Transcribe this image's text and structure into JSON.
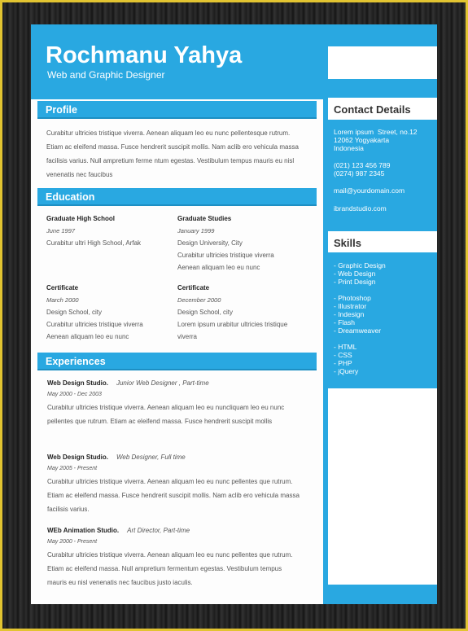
{
  "header": {
    "name": "Rochmanu Yahya",
    "role": "Web and Graphic Designer"
  },
  "profile": {
    "title": "Profile",
    "text": "Curabitur ultricies tristique viverra. Aenean aliquam leo eu nunc pellentesque rutrum. Etiam ac eleifend massa. Fusce hendrerit suscipit mollis. Nam aclib ero vehicula massa facilisis varius. Null ampretium ferme ntum egestas. Vestibulum tempus mauris eu nisl venenatis nec faucibus"
  },
  "education": {
    "title": "Education",
    "items": [
      {
        "title": "Graduate High School",
        "date": "June 1997",
        "lines": "Curabitur ultri High School, Arfak"
      },
      {
        "title": "Graduate Studies",
        "date": "January 1999",
        "lines": "Design University, City\nCurabitur ultricies tristique viverra\nAenean aliquam leo eu nunc"
      },
      {
        "title": "Certificate",
        "date": "March 2000",
        "lines": "Design School, city\nCurabitur ultricies tristique viverra\nAenean aliquam leo eu nunc"
      },
      {
        "title": "Certificate",
        "date": "December 2000",
        "lines": "Design School, city\nLorem ipsum urabitur ultricies tristique\nviverra"
      }
    ]
  },
  "experiences": {
    "title": "Experiences",
    "items": [
      {
        "company": "Web Design Studio.",
        "position": "Junior Web Designer , Part-time",
        "date": "May 2000 - Dec 2003",
        "text": "Curabitur ultricies tristique viverra. Aenean aliquam leo eu nuncliquam leo eu nunc pellentes que rutrum. Etiam ac eleifend massa. Fusce hendrerit suscipit mollis"
      },
      {
        "company": "Web Design Studio.",
        "position": "Web Designer, Full time",
        "date": "May 2005 - Present",
        "text": "Curabitur ultricies tristique viverra. Aenean aliquam leo eu nunc pellentes que rutrum. Etiam ac eleifend massa. Fusce hendrerit suscipit mollis. Nam aclib ero vehicula massa facilisis varius."
      },
      {
        "company": "WEb Animation Studio.",
        "position": "Art Director, Part-time",
        "date": "May 2000 - Present",
        "text": "Curabitur ultricies tristique viverra. Aenean aliquam leo eu nunc pellentes que rutrum. Etiam ac eleifend massa. Null ampretium fermentum egestas. Vestibulum tempus mauris eu nisl venenatis nec faucibus justo iaculis."
      }
    ]
  },
  "contact": {
    "title": "Contact Details",
    "address": "Lorem ipsum  Street, no.12\n12062 Yogyakarta\nIndonesia",
    "phones": "(021) 123 456 789\n(0274) 987 2345",
    "email": "mail@yourdomain.com",
    "website": "ibrandstudio.com"
  },
  "skills": {
    "title": "Skills",
    "design": "- Graphic Design\n- Web Design\n- Print Design",
    "software": "- Photoshop\n- Illustrator\n- Indesign\n- Flash\n- Dreamweaver",
    "code": "- HTML\n- CSS\n- PHP\n- jQuery"
  },
  "colors": {
    "accent": "#29a8e1"
  }
}
